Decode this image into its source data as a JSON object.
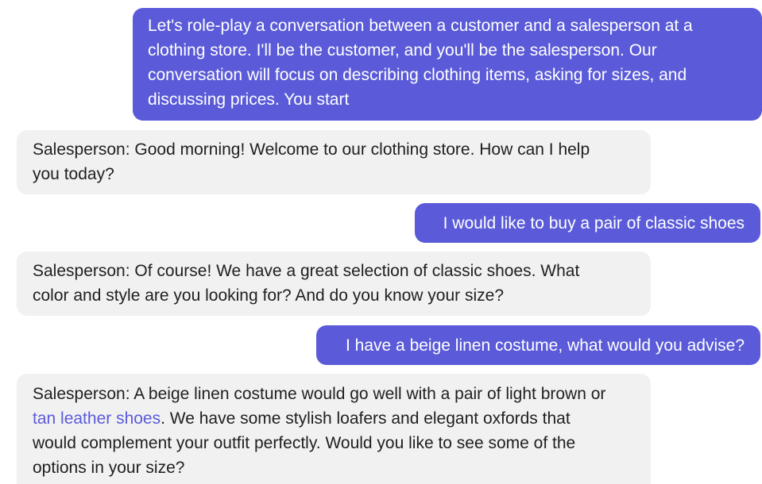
{
  "messages": [
    {
      "role": "user",
      "lines": [
        "Let's role-play a conversation between a customer and a salesperson at a",
        "clothing store. I'll be the customer, and you'll be the salesperson. Our",
        "conversation will focus on describing clothing items, asking for sizes, and",
        "discussing prices. You start"
      ]
    },
    {
      "role": "assistant",
      "lines": [
        "Salesperson: Good morning! Welcome to our clothing store. How can I help",
        "you today?"
      ]
    },
    {
      "role": "user",
      "lines": [
        "I would like to buy a pair of classic shoes"
      ]
    },
    {
      "role": "assistant",
      "lines": [
        "Salesperson: Of course! We have a great selection of classic shoes. What",
        "color and style are you looking for? And do you know your size?"
      ]
    },
    {
      "role": "user",
      "lines": [
        "I have a beige linen costume, what would you advise?"
      ]
    },
    {
      "role": "assistant",
      "line1": "Salesperson: A beige linen costume would go well with a pair of light brown or",
      "link_text": "tan leather shoes",
      "line2_rest": ". We have some stylish loafers and elegant oxfords that",
      "line3": "would complement your outfit perfectly. Would you like to see some of the",
      "line4": "options in your size?"
    }
  ],
  "colors": {
    "user_bubble": "#5b5bd9",
    "assistant_bubble": "#f1f1f2",
    "link": "#5b5bd9"
  }
}
